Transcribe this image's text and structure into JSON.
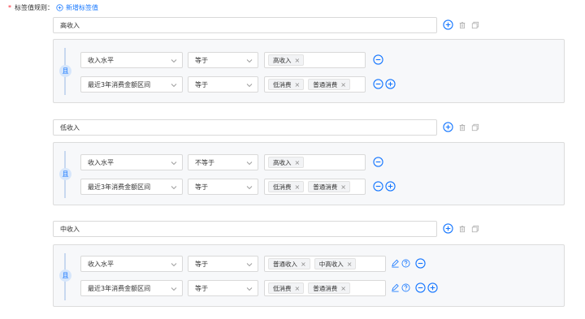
{
  "header": {
    "required_mark": "*",
    "label": "标签值规则：",
    "add_link": "新增标签值"
  },
  "colors": {
    "primary": "#1677ff",
    "required": "#f5222d",
    "and_badge_bg": "#d6e6fb",
    "panel_bg": "#f7f8fa"
  },
  "and_label": "且",
  "groups": [
    {
      "name": "高收入",
      "conditions": [
        {
          "field": "收入水平",
          "operator": "等于",
          "values": [
            "高收入"
          ]
        },
        {
          "field": "最近3年消费金额区间",
          "operator": "等于",
          "values": [
            "低消费",
            "普通消费"
          ]
        }
      ]
    },
    {
      "name": "低收入",
      "conditions": [
        {
          "field": "收入水平",
          "operator": "不等于",
          "values": [
            "高收入"
          ]
        },
        {
          "field": "最近3年消费金额区间",
          "operator": "等于",
          "values": [
            "低消费",
            "普通消费"
          ]
        }
      ]
    },
    {
      "name": "中收入",
      "conditions": [
        {
          "field": "收入水平",
          "operator": "等于",
          "values": [
            "普通收入",
            "中高收入"
          ]
        },
        {
          "field": "最近3年消费金额区间",
          "operator": "等于",
          "values": [
            "低消费",
            "普通消费"
          ]
        }
      ]
    }
  ],
  "icons": {
    "chevron": "chevron-down-icon",
    "remove_tag": "close-icon",
    "add": "plus-circle-icon",
    "remove": "minus-circle-icon",
    "delete": "trash-icon",
    "copy": "copy-icon",
    "edit": "edit-icon",
    "help": "question-circle-icon"
  }
}
